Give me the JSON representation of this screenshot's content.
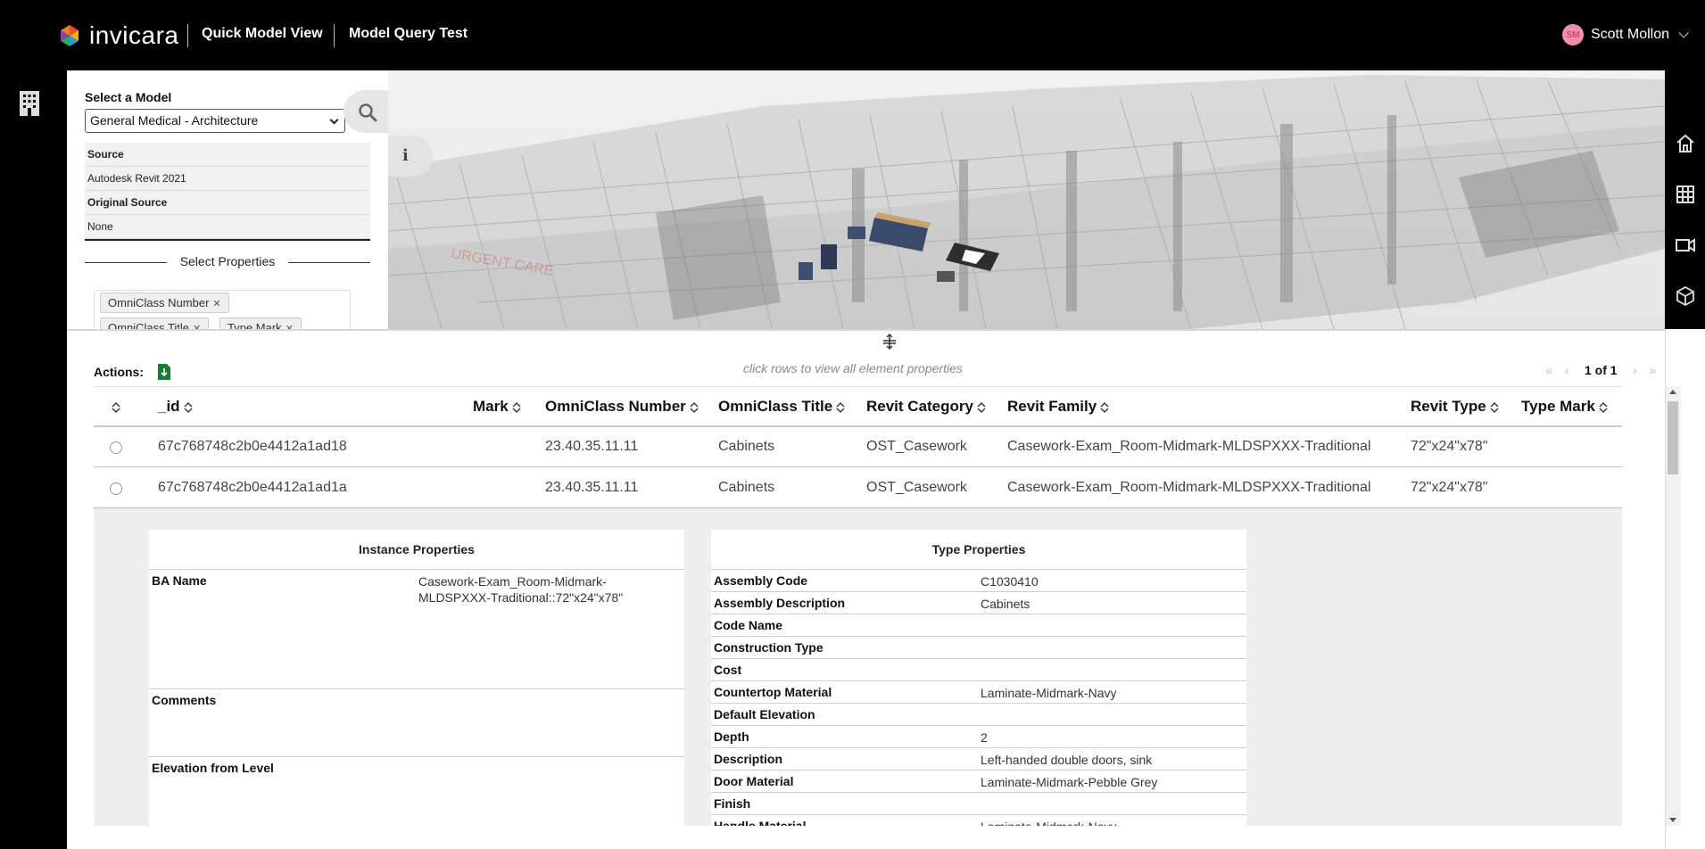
{
  "header": {
    "brand": "invicara",
    "nav": [
      "Quick Model View",
      "Model Query Test"
    ],
    "user": {
      "initials": "SM",
      "name": "Scott Mollon"
    }
  },
  "model_panel": {
    "select_label": "Select a Model",
    "selected_model": "General Medical - Architecture",
    "source_rows": [
      {
        "label": "Source",
        "kind": "head"
      },
      {
        "label": "Autodesk Revit 2021",
        "kind": "value"
      },
      {
        "label": "Original Source",
        "kind": "head"
      },
      {
        "label": "None",
        "kind": "value"
      }
    ],
    "props_label": "Select Properties",
    "chips": [
      "OmniClass Number",
      "OmniClass Title",
      "Type Mark"
    ]
  },
  "viewer": {
    "info_icon": "i"
  },
  "actions": {
    "label": "Actions:",
    "hint": "click rows to view all element properties",
    "pager_text": "1 of 1"
  },
  "grid": {
    "columns": [
      "_id",
      "Mark",
      "OmniClass Number",
      "OmniClass Title",
      "Revit Category",
      "Revit Family",
      "Revit Type",
      "Type Mark"
    ],
    "rows": [
      {
        "_id": "67c768748c2b0e4412a1ad18",
        "mark": "",
        "omniclass_number": "23.40.35.11.11",
        "omniclass_title": "Cabinets",
        "revit_category": "OST_Casework",
        "revit_family": "Casework-Exam_Room-Midmark-MLDSPXXX-Traditional",
        "revit_type": "72\"x24\"x78\"",
        "type_mark": ""
      },
      {
        "_id": "67c768748c2b0e4412a1ad1a",
        "mark": "",
        "omniclass_number": "23.40.35.11.11",
        "omniclass_title": "Cabinets",
        "revit_category": "OST_Casework",
        "revit_family": "Casework-Exam_Room-Midmark-MLDSPXXX-Traditional",
        "revit_type": "72\"x24\"x78\"",
        "type_mark": ""
      }
    ]
  },
  "detail": {
    "instance_title": "Instance Properties",
    "instance_props": [
      {
        "k": "BA Name",
        "v": "Casework-Exam_Room-Midmark-MLDSPXXX-Traditional::72\"x24\"x78\""
      },
      {
        "k": "Comments",
        "v": ""
      },
      {
        "k": "Elevation from Level",
        "v": ""
      }
    ],
    "type_title": "Type Properties",
    "type_props": [
      {
        "k": "Assembly Code",
        "v": "C1030410"
      },
      {
        "k": "Assembly Description",
        "v": "Cabinets"
      },
      {
        "k": "Code Name",
        "v": ""
      },
      {
        "k": "Construction Type",
        "v": ""
      },
      {
        "k": "Cost",
        "v": ""
      },
      {
        "k": "Countertop Material",
        "v": "Laminate-Midmark-Navy"
      },
      {
        "k": "Default Elevation",
        "v": ""
      },
      {
        "k": "Depth",
        "v": "2"
      },
      {
        "k": "Description",
        "v": "Left-handed double doors, sink"
      },
      {
        "k": "Door Material",
        "v": "Laminate-Midmark-Pebble Grey"
      },
      {
        "k": "Finish",
        "v": ""
      },
      {
        "k": "Handle Material",
        "v": "Laminate-Midmark-Navy"
      }
    ]
  },
  "colors": {
    "topbar": "#000000",
    "accent_pink": "#f08fa8",
    "excel_green": "#1f7a3a"
  }
}
